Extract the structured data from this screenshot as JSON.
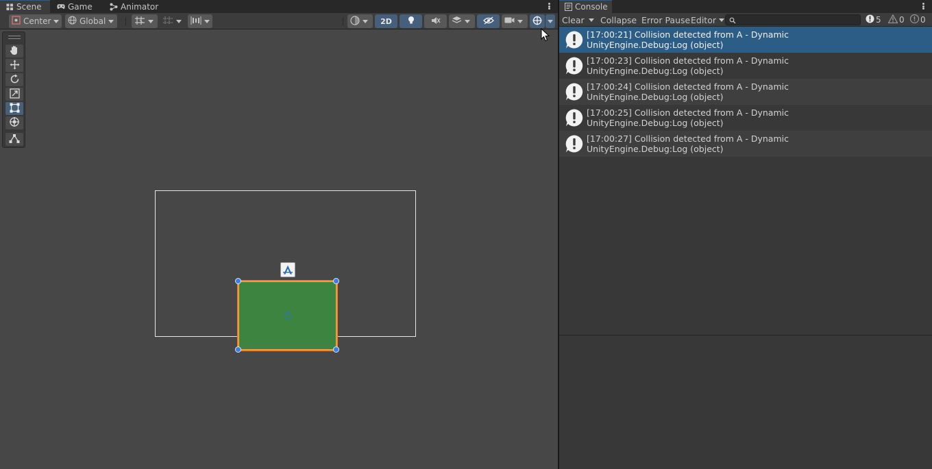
{
  "scene_panel": {
    "tabs": [
      {
        "label": "Scene",
        "icon": "scene-icon",
        "active": true
      },
      {
        "label": "Game",
        "icon": "gamepad-icon",
        "active": false
      },
      {
        "label": "Animator",
        "icon": "animator-icon",
        "active": false
      }
    ],
    "toolbar": {
      "pivot_mode": "Center",
      "pivot_rotation": "Global",
      "view_2d_label": "2D"
    },
    "tools": [
      "hand-tool",
      "move-tool",
      "rotate-tool",
      "scale-tool",
      "rect-tool",
      "transform-tool",
      "custom-tool"
    ],
    "selected_tool": "rect-tool"
  },
  "console_panel": {
    "tab": {
      "label": "Console",
      "icon": "console-icon"
    },
    "toolbar": {
      "clear_label": "Clear",
      "collapse_label": "Collapse",
      "error_pause_label": "Error Pause",
      "editor_label": "Editor",
      "search_value": ""
    },
    "counts": {
      "info": "5",
      "warning": "0",
      "error": "0"
    },
    "logs": [
      {
        "time_message": "[17:00:21] Collision detected from A - Dynamic",
        "source": "UnityEngine.Debug:Log (object)",
        "selected": true
      },
      {
        "time_message": "[17:00:23] Collision detected from A - Dynamic",
        "source": "UnityEngine.Debug:Log (object)",
        "selected": false
      },
      {
        "time_message": "[17:00:24] Collision detected from A - Dynamic",
        "source": "UnityEngine.Debug:Log (object)",
        "selected": false
      },
      {
        "time_message": "[17:00:25] Collision detected from A - Dynamic",
        "source": "UnityEngine.Debug:Log (object)",
        "selected": false
      },
      {
        "time_message": "[17:00:27] Collision detected from A - Dynamic",
        "source": "UnityEngine.Debug:Log (object)",
        "selected": false
      }
    ]
  },
  "colors": {
    "selection_blue": "#2c5d87",
    "sprite_green": "#3d8440",
    "selection_outline": "#f5822a",
    "active_button": "#46607c"
  }
}
